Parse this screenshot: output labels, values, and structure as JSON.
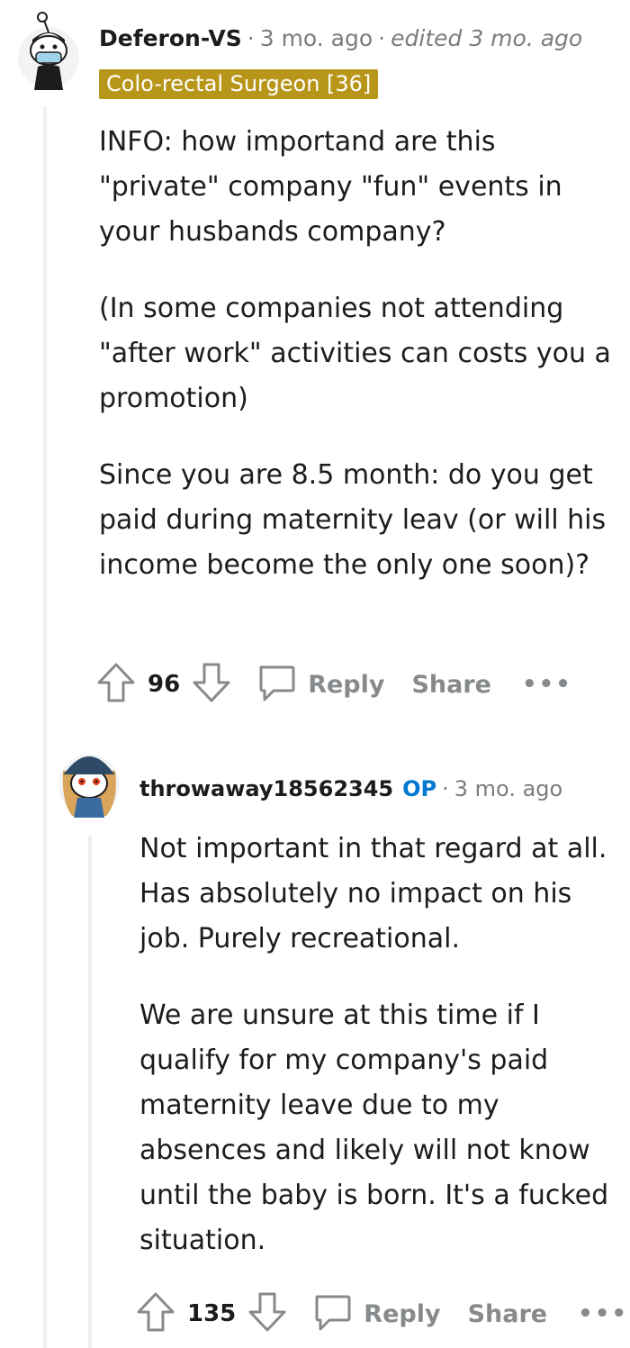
{
  "comment1": {
    "author": "Deferon-VS",
    "time": "3 mo. ago",
    "edited": "edited 3 mo. ago",
    "flair": "Colo-rectal Surgeon [36]",
    "paragraphs": [
      "INFO: how importand are this \"private\" company \"fun\" events in your husbands company?",
      "(In some companies not attending \"after work\" activities can costs you a promotion)",
      "Since you are 8.5 month: do you get paid during maternity leav (or will his income become the only one soon)?"
    ],
    "votes": "96",
    "reply_label": "Reply",
    "share_label": "Share",
    "more_label": "•••"
  },
  "comment2": {
    "author": "throwaway18562345",
    "op_badge": "OP",
    "time": "3 mo. ago",
    "paragraphs": [
      "Not important in that regard at all. Has absolutely no impact on his job. Purely recreational.",
      "We are unsure at this time if I qualify for my company's paid maternity leave due to my absences and likely will not know until the baby is born. It's a fucked situation."
    ],
    "votes": "135",
    "reply_label": "Reply",
    "share_label": "Share",
    "more_label": "•••"
  },
  "icons": [
    "avatar",
    "upvote-icon",
    "downvote-icon",
    "reply-icon",
    "more-icon"
  ],
  "colors": {
    "flair_bg": "#b8961a",
    "op_blue": "#0079d3",
    "muted": "#878a8c",
    "thread_line": "#edeff1"
  }
}
